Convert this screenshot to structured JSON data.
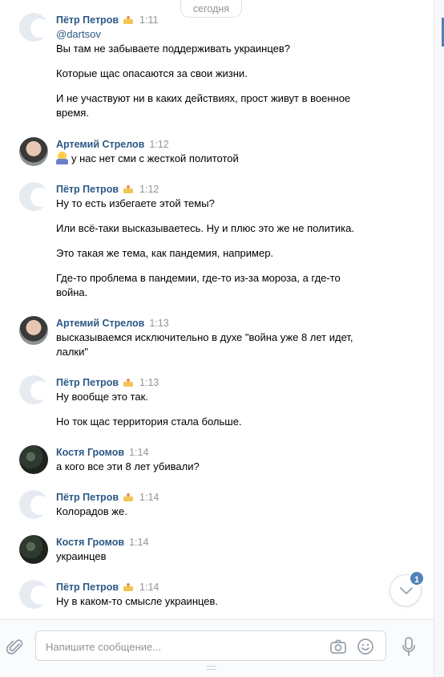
{
  "date_divider": "сегодня",
  "messages": [
    {
      "author": "Пётр Петров",
      "has_badge": true,
      "time": "1:11",
      "avatar": "placeholder",
      "lines": [
        "@dartsov",
        "Вы там не забываете поддерживать украинцев?",
        "Которые щас опасаются за свои жизни.",
        "И не участвуют ни в каких действиях, прост живут в военное",
        "время."
      ]
    },
    {
      "author": "Артемий Стрелов",
      "has_badge": false,
      "time": "1:12",
      "avatar": "photo",
      "lines": [
        "у нас нет сми с жесткой политотой"
      ]
    },
    {
      "author": "Пётр Петров",
      "has_badge": true,
      "time": "1:12",
      "avatar": "placeholder",
      "lines": [
        "Ну то есть избегаете этой темы?",
        "Или всё-таки высказываетесь. Ну и плюс это же не политика.",
        "Это такая же тема, как пандемия, например.",
        "Где-то проблема в пандемии, где-то из-за мороза, а где-то",
        "война."
      ]
    },
    {
      "author": "Артемий Стрелов",
      "has_badge": false,
      "time": "1:13",
      "avatar": "photo",
      "lines": [
        "высказываемся исключительно в духе \"война уже 8 лет идет,",
        "лалки\""
      ]
    },
    {
      "author": "Пётр Петров",
      "has_badge": true,
      "time": "1:13",
      "avatar": "placeholder",
      "lines": [
        "Ну вообще это так.",
        "Но ток щас территория стала больше."
      ]
    },
    {
      "author": "Костя Громов",
      "has_badge": false,
      "time": "1:14",
      "avatar": "photo",
      "lines": [
        "а кого все эти 8 лет убивали?"
      ]
    },
    {
      "author": "Пётр Петров",
      "has_badge": true,
      "time": "1:14",
      "avatar": "placeholder",
      "lines": [
        "Колорадов же."
      ]
    },
    {
      "author": "Костя Громов",
      "has_badge": false,
      "time": "1:14",
      "avatar": "photo",
      "lines": [
        "украинцев"
      ]
    },
    {
      "author": "Пётр Петров",
      "has_badge": true,
      "time": "1:14",
      "avatar": "placeholder",
      "lines": [
        "Ну в каком-то смысле украинцев."
      ]
    }
  ],
  "unread_count": "1",
  "composer": {
    "placeholder": "Напишите сообщение..."
  },
  "icons": {
    "attach": "paperclip-icon",
    "camera": "camera-icon",
    "smile": "emoji-smile-icon",
    "mic": "microphone-icon",
    "scroll": "chevron-down-icon",
    "badge": "cake-icon"
  },
  "colors": {
    "author": "#2a5885",
    "time": "#939393",
    "accent": "#5181b8"
  }
}
